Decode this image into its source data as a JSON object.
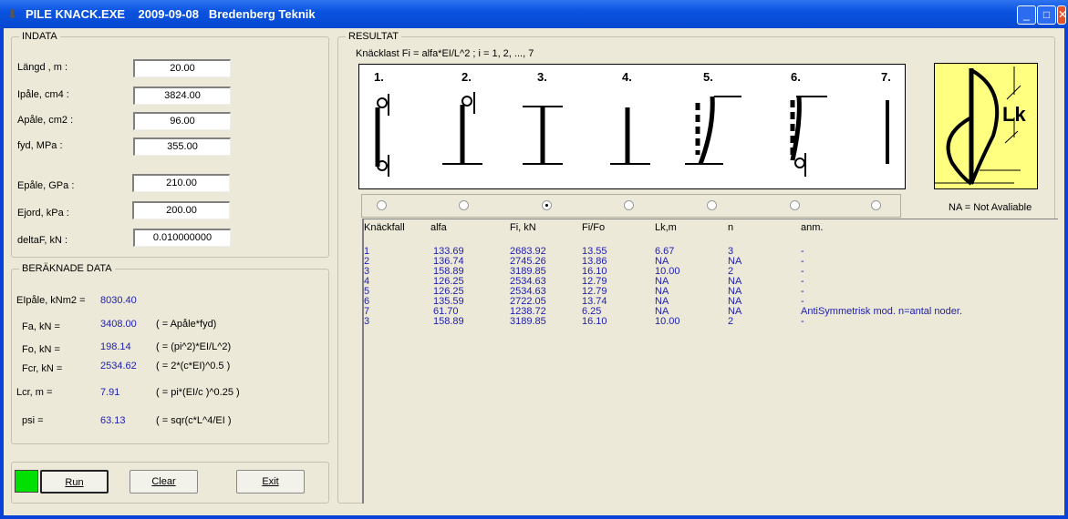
{
  "window": {
    "title": "PILE KNACK.EXE    2009-09-08   Bredenberg Teknik",
    "icon": "arrow-down-icon",
    "controls": [
      "minimize",
      "maximize",
      "close"
    ]
  },
  "indata": {
    "legend": "INDATA",
    "fields": [
      {
        "label": "Längd , m :",
        "value": "20.00"
      },
      {
        "label": "Ipåle, cm4 :",
        "value": "3824.00"
      },
      {
        "label": "Apåle, cm2 :",
        "value": "96.00"
      },
      {
        "label": "fyd, MPa :",
        "value": "355.00"
      },
      {
        "label": "Epåle, GPa :",
        "value": "210.00"
      },
      {
        "label": "Ejord, kPa :",
        "value": "200.00"
      },
      {
        "label": "deltaF, kN :",
        "value": "0.010000000"
      }
    ]
  },
  "beraknade": {
    "legend": "BERÄKNADE DATA",
    "rows": [
      {
        "label": "EIpåle, kNm2 =",
        "value": "8030.40",
        "formula": ""
      },
      {
        "label": "Fa, kN =",
        "value": "3408.00",
        "formula": "( = Apåle*fyd)"
      },
      {
        "label": "Fo, kN =",
        "value": "198.14",
        "formula": "( = (pi^2)*EI/L^2)"
      },
      {
        "label": "Fcr, kN =",
        "value": "2534.62",
        "formula": "( = 2*(c*EI)^0.5 )"
      },
      {
        "label": "Lcr, m  =",
        "value": "7.91",
        "formula": "( = pi*(EI/c )^0.25 )"
      },
      {
        "label": "psi  =",
        "value": "63.13",
        "formula": "( = sqr(c*L^4/EI )"
      }
    ]
  },
  "buttons": {
    "run": "Run",
    "clear": "Clear",
    "exit": "Exit",
    "status_color": "#00e000"
  },
  "resultat": {
    "legend": "RESULTAT",
    "formula": "Knäcklast Fi = alfa*EI/L^2  ; i = 1, 2, ..., 7",
    "cases": [
      "1.",
      "2.",
      "3.",
      "4.",
      "5.",
      "6.",
      "7."
    ],
    "selected_case": 3,
    "lk_label": "Lk",
    "na_note": "NA = Not Avaliable",
    "columns": [
      "Knäckfall",
      "alfa",
      "Fi, kN",
      "Fi/Fo",
      "Lk,m",
      "n",
      "anm."
    ],
    "rows": [
      [
        "1",
        "133.69",
        "2683.92",
        "13.55",
        "6.67",
        "3",
        "-"
      ],
      [
        "2",
        "136.74",
        "2745.26",
        "13.86",
        "NA",
        "NA",
        "-"
      ],
      [
        "3",
        "158.89",
        "3189.85",
        "16.10",
        "10.00",
        "2",
        "-"
      ],
      [
        "4",
        "126.25",
        "2534.63",
        "12.79",
        "NA",
        "NA",
        "-"
      ],
      [
        "5",
        "126.25",
        "2534.63",
        "12.79",
        "NA",
        "NA",
        "-"
      ],
      [
        "6",
        "135.59",
        "2722.05",
        "13.74",
        "NA",
        "NA",
        "-"
      ],
      [
        "7",
        "61.70",
        "1238.72",
        "6.25",
        "NA",
        "NA",
        "AntiSymmetrisk mod. n=antal noder."
      ],
      [
        "3",
        "158.89",
        "3189.85",
        "16.10",
        "10.00",
        "2",
        "-"
      ]
    ]
  }
}
